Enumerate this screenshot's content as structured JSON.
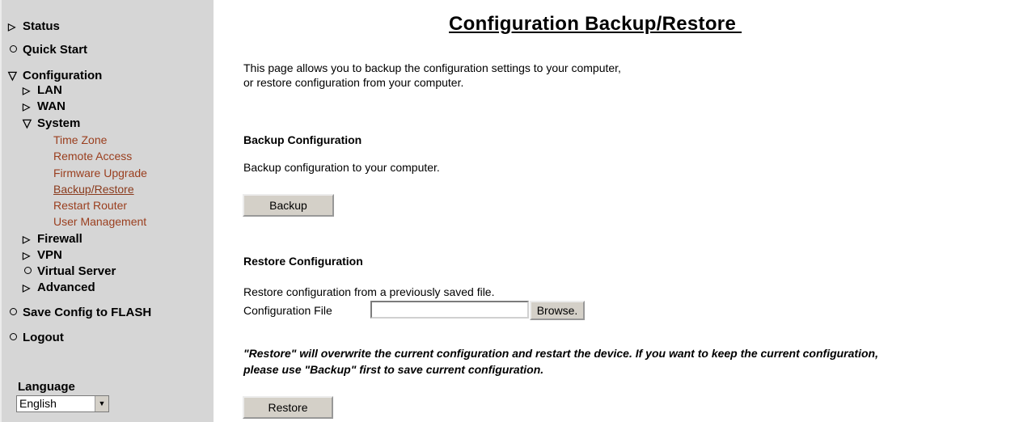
{
  "sidebar": {
    "status": "Status",
    "quick_start": "Quick Start",
    "configuration": "Configuration",
    "lan": "LAN",
    "wan": "WAN",
    "system": "System",
    "system_items": [
      "Time Zone",
      "Remote Access",
      "Firmware Upgrade",
      "Backup/Restore",
      "Restart Router",
      "User Management"
    ],
    "firewall": "Firewall",
    "vpn": "VPN",
    "virtual_server": "Virtual Server",
    "advanced": "Advanced",
    "save_config": "Save Config to FLASH",
    "logout": "Logout",
    "language_label": "Language",
    "language_value": "English"
  },
  "main": {
    "title": "Configuration Backup/Restore ",
    "intro_line1": "This page allows you to backup the configuration settings to your computer,",
    "intro_line2": "or restore configuration from your computer.",
    "backup_header": "Backup Configuration",
    "backup_text": "Backup configuration to your computer.",
    "backup_button": "Backup",
    "restore_header": "Restore Configuration",
    "restore_text": "Restore configuration from a previously saved file.",
    "file_label": "Configuration File",
    "file_value": "",
    "browse_button": "Browse.",
    "warning_line1": "\"Restore\" will overwrite the current configuration and restart the device. If you want to keep the current configuration,",
    "warning_line2": "please use \"Backup\" first to save current configuration.",
    "restore_button": "Restore"
  },
  "colors": {
    "sidebar_bg": "#d6d6d6",
    "link": "#9a3e1e",
    "button_bg": "#d4d0c8"
  }
}
